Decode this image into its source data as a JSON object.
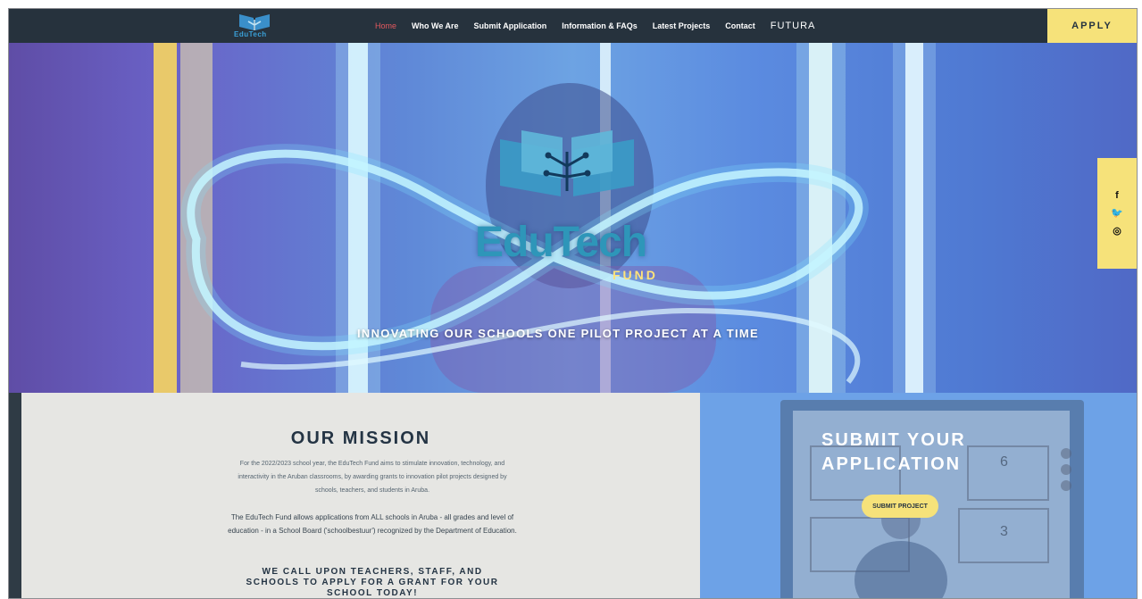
{
  "nav": {
    "logo_text": "EduTech",
    "items": [
      {
        "label": "Home",
        "active": true
      },
      {
        "label": "Who We Are"
      },
      {
        "label": "Submit Application"
      },
      {
        "label": "Information & FAQs"
      },
      {
        "label": "Latest Projects"
      },
      {
        "label": "Contact"
      },
      {
        "label": "FUTURA"
      }
    ],
    "apply": "APPLY"
  },
  "hero": {
    "brand": "EduTech",
    "brand_sub": "FUND",
    "tagline": "INNOVATING OUR SCHOOLS ONE PILOT PROJECT AT A TIME"
  },
  "social": {
    "facebook": "f",
    "twitter": "🐦",
    "instagram": "◎"
  },
  "mission": {
    "title": "OUR MISSION",
    "p1": "For the 2022/2023 school year, the EduTech Fund aims to stimulate innovation, technology, and interactivity in the Aruban classrooms, by awarding grants to innovation pilot projects designed by schools, teachers, and students in Aruba.",
    "p2": "The EduTech Fund allows applications from ALL schools in Aruba - all grades and level of education - in a School Board ('schoolbestuur') recognized by the Department of Education.",
    "call": "WE CALL UPON TEACHERS, STAFF, AND SCHOOLS TO APPLY FOR A GRANT FOR YOUR SCHOOL TODAY!"
  },
  "submit": {
    "title_line1": "SUBMIT YOUR",
    "title_line2": "APPLICATION",
    "button": "SUBMIT PROJECT",
    "board_numbers": [
      "6",
      "3"
    ]
  },
  "colors": {
    "nav_bg": "#26323d",
    "accent_yellow": "#f6e27a",
    "active_link": "#e3595f",
    "mission_bg": "#e6e6e3",
    "submit_bg": "#6da2e7"
  }
}
